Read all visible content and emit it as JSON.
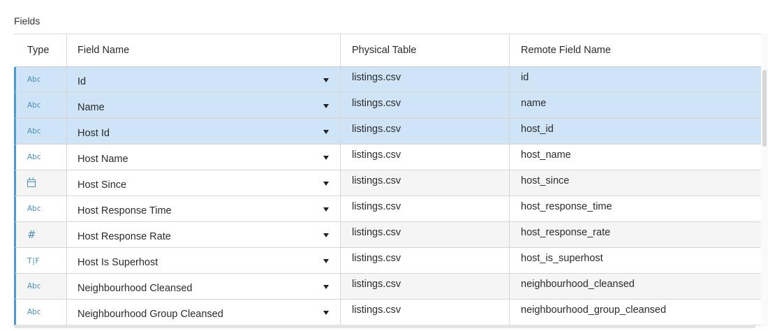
{
  "section_title": "Fields",
  "columns": {
    "type": "Type",
    "field_name": "Field Name",
    "physical_table": "Physical Table",
    "remote_field_name": "Remote Field Name"
  },
  "colors": {
    "selected_row": "#cfe4f7",
    "accent": "#4b9cc9"
  },
  "rows": [
    {
      "type_icon": "Abc",
      "type_icon_name": "string-type-icon",
      "field_name": "Id",
      "physical_table": "listings.csv",
      "remote_field_name": "id",
      "selected": true
    },
    {
      "type_icon": "Abc",
      "type_icon_name": "string-type-icon",
      "field_name": "Name",
      "physical_table": "listings.csv",
      "remote_field_name": "name",
      "selected": true
    },
    {
      "type_icon": "Abc",
      "type_icon_name": "string-type-icon",
      "field_name": "Host Id",
      "physical_table": "listings.csv",
      "remote_field_name": "host_id",
      "selected": true
    },
    {
      "type_icon": "Abc",
      "type_icon_name": "string-type-icon",
      "field_name": "Host Name",
      "physical_table": "listings.csv",
      "remote_field_name": "host_name",
      "selected": false
    },
    {
      "type_icon": "",
      "type_icon_name": "date-type-icon",
      "field_name": "Host Since",
      "physical_table": "listings.csv",
      "remote_field_name": "host_since",
      "selected": false
    },
    {
      "type_icon": "Abc",
      "type_icon_name": "string-type-icon",
      "field_name": "Host Response Time",
      "physical_table": "listings.csv",
      "remote_field_name": "host_response_time",
      "selected": false
    },
    {
      "type_icon": "#",
      "type_icon_name": "number-type-icon",
      "field_name": "Host Response Rate",
      "physical_table": "listings.csv",
      "remote_field_name": "host_response_rate",
      "selected": false
    },
    {
      "type_icon": "T|F",
      "type_icon_name": "boolean-type-icon",
      "field_name": "Host Is Superhost",
      "physical_table": "listings.csv",
      "remote_field_name": "host_is_superhost",
      "selected": false
    },
    {
      "type_icon": "Abc",
      "type_icon_name": "string-type-icon",
      "field_name": "Neighbourhood Cleansed",
      "physical_table": "listings.csv",
      "remote_field_name": "neighbourhood_cleansed",
      "selected": false
    },
    {
      "type_icon": "Abc",
      "type_icon_name": "string-type-icon",
      "field_name": "Neighbourhood Group Cleansed",
      "physical_table": "listings.csv",
      "remote_field_name": "neighbourhood_group_cleansed",
      "selected": false
    }
  ]
}
